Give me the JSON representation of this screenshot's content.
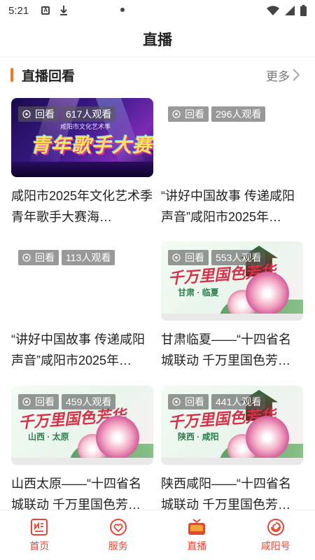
{
  "status_bar": {
    "time": "5:21",
    "left_icons": [
      "a-icon",
      "download-icon"
    ],
    "right_icons": [
      "wifi-icon",
      "signal-icon",
      "battery-icon"
    ]
  },
  "header": {
    "title": "直播"
  },
  "section": {
    "title": "直播回看",
    "more_label": "更多"
  },
  "cards": [
    {
      "badge_label": "回看",
      "viewers": "617人观看",
      "title": "咸阳市2025年文化艺术季青年歌手大赛海…",
      "thumb_text": "青年歌手大赛",
      "thumb_subtext": "咸阳市文化艺术季",
      "thumbnail": "concert"
    },
    {
      "badge_label": "回看",
      "viewers": "296人观看",
      "title": "“讲好中国故事 传递咸阳声音”咸阳市2025年…",
      "thumbnail": "blank"
    },
    {
      "badge_label": "回看",
      "viewers": "113人观看",
      "title": "“讲好中国故事 传递咸阳声音”咸阳市2025年…",
      "thumbnail": "blank"
    },
    {
      "badge_label": "回看",
      "viewers": "553人观看",
      "title": "甘肃临夏——“十四省名城联动 千万里国色芳…",
      "thumb_text": "千万里国色芳华",
      "thumb_subtext": "甘肃 · 临夏",
      "thumbnail": "peony"
    },
    {
      "badge_label": "回看",
      "viewers": "459人观看",
      "title": "山西太原——“十四省名城联动 千万里国色芳…",
      "thumb_text": "千万里国色芳华",
      "thumb_subtext": "山西 · 太原",
      "thumbnail": "peony"
    },
    {
      "badge_label": "回看",
      "viewers": "441人观看",
      "title": "陕西咸阳——“十四省名城联动 千万里国色芳…",
      "thumb_text": "千万里国色芳华",
      "thumb_subtext": "陕西 · 咸阳",
      "thumbnail": "peony"
    }
  ],
  "bottom_nav": [
    {
      "label": "首页",
      "icon": "news-icon"
    },
    {
      "label": "服务",
      "icon": "heart-shield-icon"
    },
    {
      "label": "直播",
      "icon": "tv-icon",
      "active": true
    },
    {
      "label": "咸阳号",
      "icon": "swirl-logo-icon"
    }
  ],
  "colors": {
    "accent": "#f47a21",
    "nav": "#e8452f",
    "badge_bg": "#5a5a5a"
  }
}
